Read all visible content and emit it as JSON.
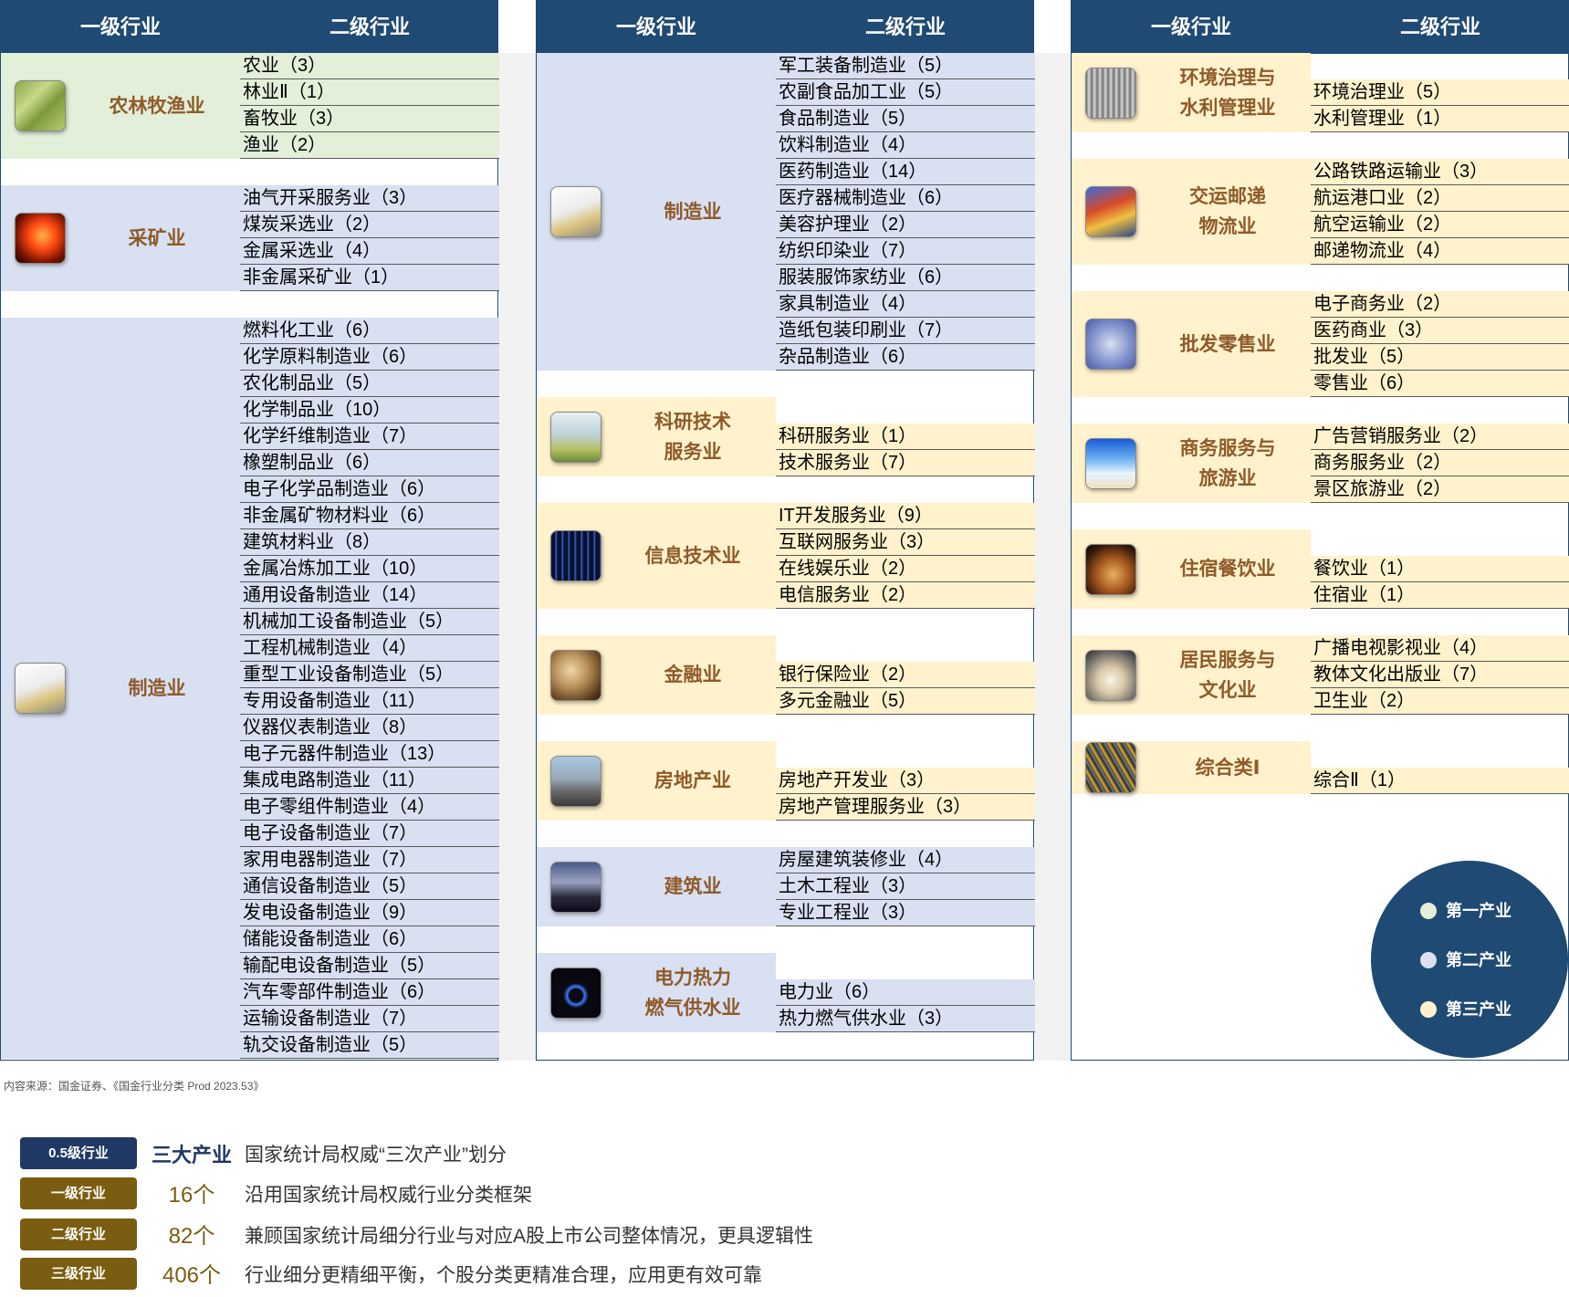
{
  "headers": {
    "level1": "一级行业",
    "level2": "二级行业"
  },
  "colors": {
    "header_bg": "#1f4a73",
    "primary": "#e2efd9",
    "secondary": "#d9e0f2",
    "tertiary": "#fff2cc",
    "name_text": "#8f5a2a",
    "level_brown": "#7a5d10"
  },
  "panels": [
    {
      "groups": [
        {
          "name": "农林牧渔业",
          "icon": "field-icon",
          "sector": "g1",
          "items": [
            "农业（3）",
            "林业Ⅱ（1）",
            "畜牧业（3）",
            "渔业（2）"
          ]
        },
        {
          "name": "采矿业",
          "icon": "molten-metal-icon",
          "sector": "g2",
          "items": [
            "油气开采服务业（3）",
            "煤炭采选业（2）",
            "金属采选业（4）",
            "非金属采矿业（1）"
          ]
        },
        {
          "name": "制造业",
          "icon": "robot-arm-icon",
          "sector": "g2",
          "items": [
            "燃料化工业（6）",
            "化学原料制造业（6）",
            "农化制品业（5）",
            "化学制品业（10）",
            "化学纤维制造业（7）",
            "橡塑制品业（6）",
            "电子化学品制造业（6）",
            "非金属矿物材料业（6）",
            "建筑材料业（8）",
            "金属冶炼加工业（10）",
            "通用设备制造业（14）",
            "机械加工设备制造业（5）",
            "工程机械制造业（4）",
            "重型工业设备制造业（5）",
            "专用设备制造业（11）",
            "仪器仪表制造业（8）",
            "电子元器件制造业（13）",
            "集成电路制造业（11）",
            "电子零组件制造业（4）",
            "电子设备制造业（7）",
            "家用电器制造业（7）",
            "通信设备制造业（5）",
            "发电设备制造业（9）",
            "储能设备制造业（6）",
            "输配电设备制造业（5）",
            "汽车零部件制造业（6）",
            "运输设备制造业（7）",
            "轨交设备制造业（5）"
          ]
        }
      ]
    },
    {
      "groups": [
        {
          "name": "制造业",
          "icon": "robot-arm-icon",
          "sector": "g2",
          "items": [
            "军工装备制造业（5）",
            "农副食品加工业（5）",
            "食品制造业（5）",
            "饮料制造业（4）",
            "医药制造业（14）",
            "医疗器械制造业（6）",
            "美容护理业（2）",
            "纺织印染业（7）",
            "服装服饰家纺业（6）",
            "家具制造业（4）",
            "造纸包装印刷业（7）",
            "杂品制造业（6）"
          ]
        },
        {
          "name": "科研技术\n服务业",
          "icon": "lab-flask-icon",
          "sector": "g3",
          "items": [
            "科研服务业（1）",
            "技术服务业（7）"
          ]
        },
        {
          "name": "信息技术业",
          "icon": "binary-code-icon",
          "sector": "g3",
          "items": [
            "IT开发服务业（9）",
            "互联网服务业（3）",
            "在线娱乐业（2）",
            "电信服务业（2）"
          ]
        },
        {
          "name": "金融业",
          "icon": "coins-icon",
          "sector": "g3",
          "items": [
            "银行保险业（2）",
            "多元金融业（5）"
          ]
        },
        {
          "name": "房地产业",
          "icon": "skyline-icon",
          "sector": "g3",
          "items": [
            "房地产开发业（3）",
            "房地产管理服务业（3）"
          ]
        },
        {
          "name": "建筑业",
          "icon": "bridge-icon",
          "sector": "g2",
          "items": [
            "房屋建筑装修业（4）",
            "土木工程业（3）",
            "专业工程业（3）"
          ]
        },
        {
          "name": "电力热力\n燃气供水业",
          "icon": "gas-flame-icon",
          "sector": "g2",
          "items": [
            "电力业（6）",
            "热力燃气供水业（3）"
          ]
        }
      ]
    },
    {
      "groups": [
        {
          "name": "环境治理与\n水利管理业",
          "icon": "water-gate-icon",
          "sector": "g3",
          "items": [
            "环境治理业（5）",
            "水利管理业（1）"
          ]
        },
        {
          "name": "交运邮递\n物流业",
          "icon": "container-port-icon",
          "sector": "g3",
          "items": [
            "公路铁路运输业（3）",
            "航运港口业（2）",
            "航空运输业（2）",
            "邮递物流业（4）"
          ]
        },
        {
          "name": "批发零售业",
          "icon": "shopping-cart-icon",
          "sector": "g3",
          "items": [
            "电子商务业（2）",
            "医药商业（3）",
            "批发业（5）",
            "零售业（6）"
          ]
        },
        {
          "name": "商务服务与\n旅游业",
          "icon": "beach-icon",
          "sector": "g3",
          "items": [
            "广告营销服务业（2）",
            "商务服务业（2）",
            "景区旅游业（2）"
          ]
        },
        {
          "name": "住宿餐饮业",
          "icon": "burger-icon",
          "sector": "g3",
          "items": [
            "餐饮业（1）",
            "住宿业（1）"
          ]
        },
        {
          "name": "居民服务与\n文化业",
          "icon": "open-book-icon",
          "sector": "g3",
          "items": [
            "广播电视影视业（4）",
            "教体文化出版业（7）",
            "卫生业（2）"
          ]
        },
        {
          "name": "综合类Ⅰ",
          "icon": "mesh-pattern-icon",
          "sector": "g3",
          "items": [
            "综合Ⅱ（1）"
          ]
        }
      ]
    }
  ],
  "source": "内容来源：国金证券、《国金行业分类 Prod 2023.53》",
  "legend": [
    {
      "label": "第一产业",
      "color": "#e2efd9"
    },
    {
      "label": "第二产业",
      "color": "#d9e0f2"
    },
    {
      "label": "第三产业",
      "color": "#fff2cc"
    }
  ],
  "levels": [
    {
      "badge": "0.5级行业",
      "count": "三大产业",
      "desc": "国家统计局权威“三次产业”划分",
      "badge_color": "#1f3864"
    },
    {
      "badge": "一级行业",
      "count": "16个",
      "desc": "沿用国家统计局权威行业分类框架",
      "badge_color": "#7a5d10"
    },
    {
      "badge": "二级行业",
      "count": "82个",
      "desc": "兼顾国家统计局细分行业与对应A股上市公司整体情况，更具逻辑性",
      "badge_color": "#7a5d10"
    },
    {
      "badge": "三级行业",
      "count": "406个",
      "desc": "行业细分更精细平衡，个股分类更精准合理，应用更有效可靠",
      "badge_color": "#7a5d10"
    }
  ]
}
